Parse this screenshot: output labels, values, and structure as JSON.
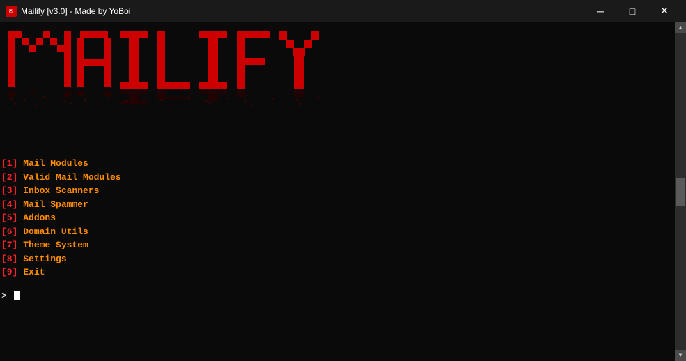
{
  "titlebar": {
    "icon": "✉",
    "title": "Mailify [v3.0] - Made by YoBoi",
    "minimize_label": "─",
    "maximize_label": "□",
    "close_label": "✕"
  },
  "menu": {
    "items": [
      {
        "num": "1",
        "label": "Mail Modules"
      },
      {
        "num": "2",
        "label": "Valid Mail Modules"
      },
      {
        "num": "3",
        "label": "Inbox Scanners"
      },
      {
        "num": "4",
        "label": "Mail Spammer"
      },
      {
        "num": "5",
        "label": "Addons"
      },
      {
        "num": "6",
        "label": "Domain Utils"
      },
      {
        "num": "7",
        "label": "Theme System"
      },
      {
        "num": "8",
        "label": "Settings"
      },
      {
        "num": "9",
        "label": "Exit"
      }
    ]
  },
  "prompt": {
    "char": ">"
  },
  "colors": {
    "background": "#0a0a0a",
    "titlebar_bg": "#1a1a1a",
    "accent_red": "#ff2222",
    "accent_orange": "#ff8c00",
    "text_white": "#ffffff"
  }
}
